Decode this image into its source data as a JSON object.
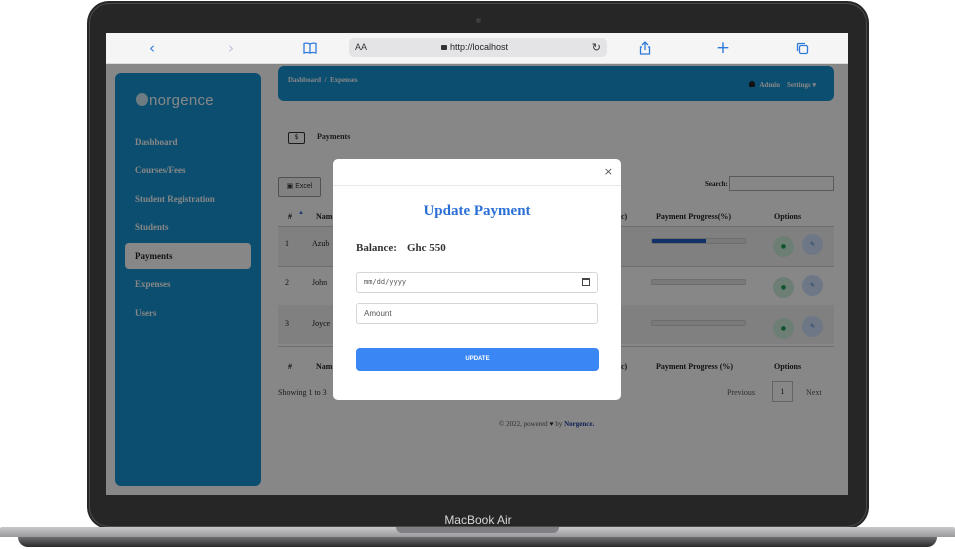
{
  "device": {
    "label": "MacBook Air"
  },
  "browser": {
    "text_size_label": "AA",
    "url": "http://localhost"
  },
  "app": {
    "brand": "norgence",
    "brand_mark": "n",
    "nav": [
      {
        "label": "Dashboard",
        "active": false
      },
      {
        "label": "Courses/Fees",
        "active": false
      },
      {
        "label": "Student Registration",
        "active": false
      },
      {
        "label": "Students",
        "active": false
      },
      {
        "label": "Payments",
        "active": true
      },
      {
        "label": "Expenses",
        "active": false
      },
      {
        "label": "Users",
        "active": false
      }
    ],
    "breadcrumb": "Dashboard  /  Expenses",
    "topbar": {
      "user": "Admin",
      "settings": "Settings"
    },
    "page_title": "Payments",
    "excel_label": "Excel",
    "search_label": "Search:",
    "table": {
      "header": {
        "index": "#",
        "name": "Nam",
        "balance_fragment": "c)",
        "progress": "Payment Progress(%)",
        "options": "Options"
      },
      "footer": {
        "index": "#",
        "name": "Nam",
        "balance_fragment": "c)",
        "progress": "Payment Progress (%)",
        "options": "Options"
      },
      "rows": [
        {
          "index": "1",
          "name": "Azub",
          "progress": 0.58
        },
        {
          "index": "2",
          "name": "John",
          "progress": 0
        },
        {
          "index": "3",
          "name": "Joyce",
          "progress": 0
        }
      ]
    },
    "showing": "Showing 1 to 3",
    "pager": {
      "previous": "Previous",
      "page": "1",
      "next": "Next"
    },
    "footer": {
      "prefix": "© 2022, powered",
      "by": "by",
      "brand": "Norgence."
    }
  },
  "modal": {
    "close": "×",
    "title": "Update Payment",
    "balance_label": "Balance:",
    "balance_value": "Ghc 550",
    "date_placeholder": "mm/dd/yyyy",
    "amount_placeholder": "Amount",
    "button": "UPDATE"
  },
  "colors": {
    "primary": "#1793d1",
    "button": "#3a86f5",
    "title": "#2b6fd6"
  }
}
